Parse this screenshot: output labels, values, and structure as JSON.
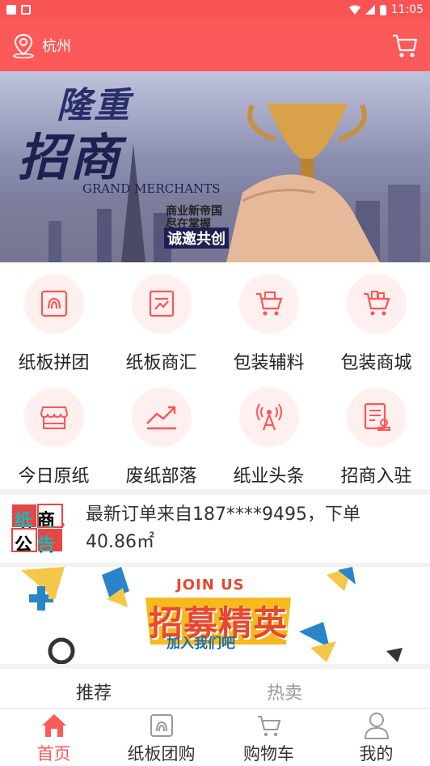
{
  "status_bar": {
    "time": "11:05"
  },
  "header": {
    "city": "杭州",
    "location_icon": "location-pin-icon",
    "cart_icon": "cart-icon"
  },
  "banner": {
    "title_line1": "隆重",
    "title_line2": "招商",
    "english": "GRAND MERCHANTS",
    "slogan_line1": "商业新帝国",
    "slogan_line2": "尽在掌握",
    "slogan_line3": "诚邀共创"
  },
  "menu": [
    {
      "label": "纸板拼团",
      "icon": "cardboard-group-icon"
    },
    {
      "label": "纸板商汇",
      "icon": "chart-icon"
    },
    {
      "label": "包装辅料",
      "icon": "cart-icon"
    },
    {
      "label": "包装商城",
      "icon": "cart-icon"
    },
    {
      "label": "今日原纸",
      "icon": "store-icon"
    },
    {
      "label": "废纸部落",
      "icon": "trend-icon"
    },
    {
      "label": "纸业头条",
      "icon": "broadcast-icon"
    },
    {
      "label": "招商入驻",
      "icon": "document-icon"
    }
  ],
  "notice": {
    "badge_line1": "纸商",
    "badge_line2": "公告",
    "text": "最新订单来自187****9495，下单40.86㎡"
  },
  "join_banner": {
    "title": "JOIN US",
    "main": "招募精英",
    "sub": "加入我们吧"
  },
  "tabs": [
    {
      "label": "推荐",
      "active": true
    },
    {
      "label": "热卖",
      "active": false
    }
  ],
  "bottom_nav": [
    {
      "label": "首页",
      "icon": "home-icon",
      "active": true
    },
    {
      "label": "纸板团购",
      "icon": "cardboard-icon",
      "active": false
    },
    {
      "label": "购物车",
      "icon": "cart-icon",
      "active": false
    },
    {
      "label": "我的",
      "icon": "user-icon",
      "active": false
    }
  ],
  "colors": {
    "accent": "#fc5a5a",
    "inactive": "#999999"
  }
}
